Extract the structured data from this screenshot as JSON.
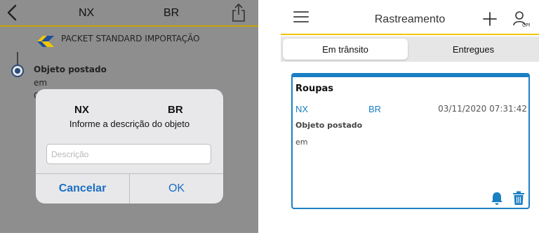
{
  "left": {
    "nav": {
      "code_from": "NX",
      "code_to": "BR",
      "back_icon": "chevron-left-icon",
      "share_icon": "share-icon"
    },
    "carrier": {
      "name": "PACKET STANDARD IMPORTAÇÃO",
      "logo_icon": "correios-logo"
    },
    "event": {
      "status": "Objeto postado",
      "location": "em",
      "partial": "C"
    },
    "dialog": {
      "code_from": "NX",
      "code_to": "BR",
      "message": "Informe a descrição do objeto",
      "input_placeholder": "Descrição",
      "input_value": "",
      "cancel_label": "Cancelar",
      "ok_label": "OK"
    },
    "colors": {
      "accent": "#1b6ec2",
      "overlay": "#8e8e8e",
      "nav_border": "#c9a400"
    }
  },
  "right": {
    "header": {
      "title": "Rastreamento",
      "menu_icon": "hamburger-menu-icon",
      "add_icon": "plus-icon",
      "cpf_icon": "user-cpf-icon"
    },
    "tabs": [
      {
        "label": "Em trânsito",
        "active": true
      },
      {
        "label": "Entregues",
        "active": false
      }
    ],
    "card": {
      "title": "Roupas",
      "code_from": "NX",
      "code_to": "BR",
      "datetime": "03/11/2020 07:31:42",
      "status": "Objeto postado",
      "location": "em",
      "bell_icon": "bell-icon",
      "trash_icon": "trash-icon"
    },
    "colors": {
      "accent": "#1b7fc4",
      "header_border": "#f2c500"
    }
  }
}
